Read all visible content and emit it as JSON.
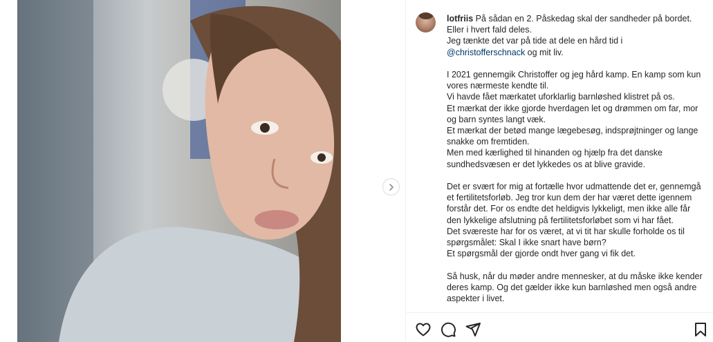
{
  "post": {
    "username": "lotfriis",
    "caption": {
      "first_line_text": " På sådan en 2. Påskedag skal der sandheder på bordet.",
      "lines_p1": [
        "Eller i hvert fald deles.",
        "Jeg tænkte det var på tide at dele en hård tid i"
      ],
      "mention": "@christofferschnack",
      "after_mention": " og mit liv.",
      "p2": [
        "I 2021 gennemgik Christoffer og jeg hård kamp. En kamp som kun vores nærmeste kendte til.",
        "Vi havde fået mærkatet uforklarlig barnløshed klistret på os.",
        "Et mærkat der ikke gjorde hverdagen let og drømmen om far, mor og barn syntes langt væk.",
        "Et mærkat der betød mange lægebesøg, indsprøjtninger og lange snakke om fremtiden.",
        "Men med kærlighed til hinanden og hjælp fra det danske sundhedsvæsen er det lykkedes os at blive gravide."
      ],
      "p3": [
        "Det er svært for mig at fortælle hvor udmattende det er, gennemgå et fertilitetsforløb. Jeg tror kun dem der har været dette igennem forstår det. For os endte det heldigvis lykkeligt, men ikke alle får den lykkelige afslutning på fertilitetsforløbet som vi har fået.",
        "Det sværeste har for os været, at vi tit har skulle forholde os til spørgsmålet: Skal I ikke snart have børn?",
        "Et spørgsmål der gjorde ondt hver gang vi fik det."
      ],
      "p4": [
        "Så husk, når du møder andre mennesker, at du måske ikke kender deres kamp. Og det gælder ikke kun barnløshed men også andre aspekter i livet."
      ]
    }
  },
  "icons": {
    "next": "chevron-right-icon",
    "like": "heart-icon",
    "comment": "comment-icon",
    "share": "send-icon",
    "save": "bookmark-icon"
  }
}
